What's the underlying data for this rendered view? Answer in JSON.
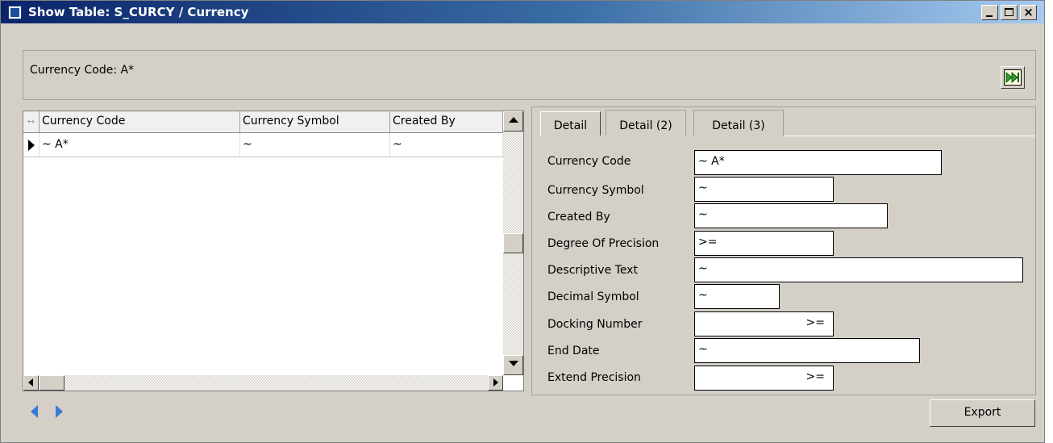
{
  "window": {
    "title": "Show Table: S_CURCY / Currency",
    "close_glyph": "×"
  },
  "query": {
    "label": "Currency Code: A*"
  },
  "grid": {
    "corner_glyph": "↔",
    "columns": [
      "Currency Code",
      "Currency Symbol",
      "Created By"
    ],
    "rows": [
      [
        "~ A*",
        "~",
        "~"
      ]
    ]
  },
  "tabs": [
    "Detail",
    "Detail (2)",
    "Detail (3)"
  ],
  "fields": [
    {
      "label": "Currency Code",
      "value": "~ A*"
    },
    {
      "label": "Currency Symbol",
      "value": "~"
    },
    {
      "label": "Created By",
      "value": "~"
    },
    {
      "label": "Degree Of Precision",
      "value": ">="
    },
    {
      "label": "Descriptive Text",
      "value": "~"
    },
    {
      "label": "Decimal Symbol",
      "value": "~"
    },
    {
      "label": "Docking Number",
      "value": ">="
    },
    {
      "label": "End Date",
      "value": "~"
    },
    {
      "label": "Extend Precision",
      "value": ">="
    }
  ],
  "buttons": {
    "export": "Export"
  },
  "colors": {
    "title_start": "#0a246a",
    "title_end": "#a6caf0",
    "window_face": "#d4d0c8",
    "nav_arrow": "#3a7bd5"
  }
}
